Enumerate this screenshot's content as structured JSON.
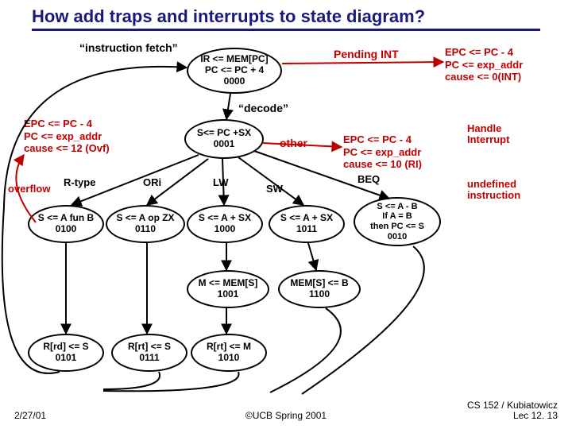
{
  "title": "How add traps and interrupts to state diagram?",
  "labels": {
    "ifetch": "“instruction fetch”",
    "decode": "“decode”",
    "other": "other",
    "overflow": "overflow",
    "pending_int": "Pending INT",
    "handle_interrupt": "Handle Interrupt",
    "undefined_instr": "undefined instruction",
    "rtype": "R-type",
    "ori": "ORi",
    "lw": "LW",
    "sw": "SW",
    "beq": "BEQ"
  },
  "ovf_box": {
    "l1": "EPC <= PC - 4",
    "l2": "PC <= exp_addr",
    "l3": "cause <= 12 (Ovf)"
  },
  "ri_box": {
    "l1": "EPC <= PC - 4",
    "l2": "PC <= exp_addr",
    "l3": "cause <= 10 (RI)"
  },
  "int_box": {
    "l1": "EPC <= PC - 4",
    "l2": "PC <= exp_addr",
    "l3": "cause <= 0(INT)"
  },
  "nodes": {
    "n0000": {
      "l1": "IR <= MEM[PC]",
      "l2": "PC <= PC + 4",
      "num": "0000"
    },
    "n0001": {
      "l1": "S<= PC +SX",
      "num": "0001"
    },
    "n0100": {
      "l1": "S <= A fun B",
      "num": "0100"
    },
    "n0110": {
      "l1": "S <= A op ZX",
      "num": "0110"
    },
    "n1000": {
      "l1": "S <= A + SX",
      "num": "1000"
    },
    "n1011": {
      "l1": "S <= A + SX",
      "num": "1011"
    },
    "n0010": {
      "l1": "S <= A - B",
      "l2": "If A = B",
      "l3": "then PC <= S",
      "num": "0010"
    },
    "n1001": {
      "l1": "M <= MEM[S]",
      "num": "1001"
    },
    "n1100": {
      "l1": "MEM[S] <= B",
      "num": "1100"
    },
    "n0101": {
      "l1": "R[rd] <= S",
      "num": "0101"
    },
    "n0111": {
      "l1": "R[rt] <= S",
      "num": "0111"
    },
    "n1010": {
      "l1": "R[rt] <= M",
      "num": "1010"
    }
  },
  "footer": {
    "date": "2/27/01",
    "center": "©UCB Spring 2001",
    "right1": "CS 152 / Kubiatowicz",
    "right2": "Lec 12. 13"
  }
}
